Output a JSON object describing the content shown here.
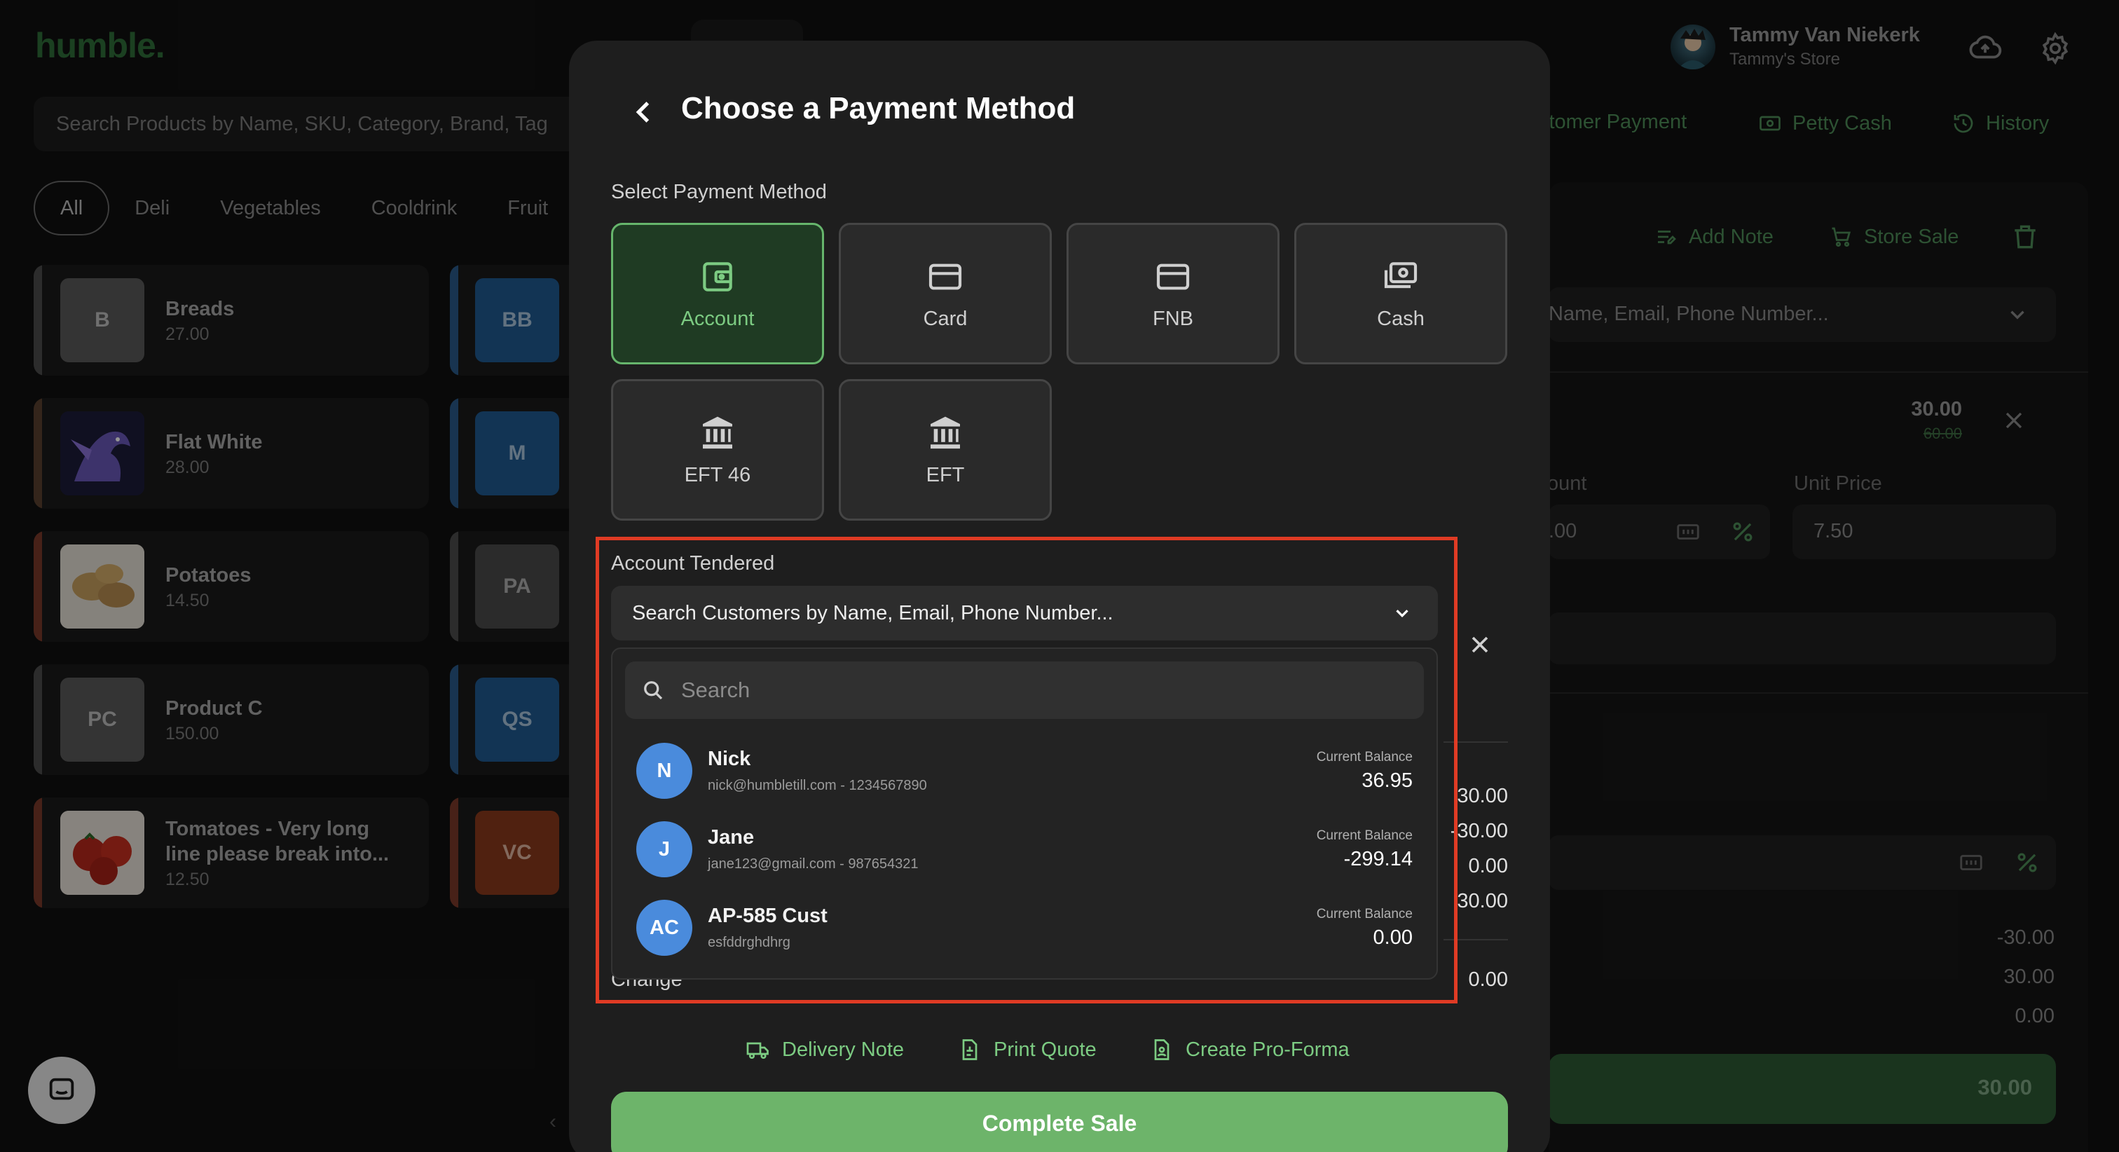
{
  "app": {
    "logo": "humble.",
    "user_name": "Tammy Van Niekerk",
    "store_name": "Tammy's Store",
    "search_placeholder": "Search Products by Name, SKU, Category, Brand, Tag",
    "links": {
      "customer_payment": "stomer Payment",
      "petty_cash": "Petty Cash",
      "history": "History"
    },
    "categories": [
      "All",
      "Deli",
      "Vegetables",
      "Cooldrink",
      "Fruit"
    ],
    "products": [
      {
        "initials": "B",
        "name": "Breads",
        "price": "27.00",
        "bar": "#4d4d4d",
        "thumb": "#5a5a5a"
      },
      {
        "initials": "",
        "name": "Flat White",
        "price": "28.00",
        "bar": "#5a4030",
        "thumb": "#2b2b55"
      },
      {
        "initials": "",
        "name": "Potatoes",
        "price": "14.50",
        "bar": "#7a3a2a",
        "thumb": "#caa46a"
      },
      {
        "initials": "PC",
        "name": "Product C",
        "price": "150.00",
        "bar": "#4d4d4d",
        "thumb": "#5a5a5a"
      },
      {
        "initials": "",
        "name": "Tomatoes - Very long line please break into...",
        "price": "12.50",
        "bar": "#7a3a2a",
        "thumb": "#b33a2a"
      }
    ],
    "tiles": [
      {
        "initials": "BB",
        "color": "#1f5a92"
      },
      {
        "initials": "M",
        "color": "#1f5a92"
      },
      {
        "initials": "PA",
        "color": "#4a4a4a"
      },
      {
        "initials": "QS",
        "color": "#1f5a92"
      },
      {
        "initials": "VC",
        "color": "#8a3a1c"
      }
    ],
    "right": {
      "add_note": "Add Note",
      "store_sale": "Store Sale",
      "customer_search": "Name, Email, Phone Number...",
      "item_price": "30.00",
      "item_old_price": "60.00",
      "discount_label": "ount",
      "discount_value": ".00",
      "unit_price_label": "Unit Price",
      "unit_price_value": "7.50",
      "totals": [
        "-30.00",
        "30.00",
        "0.00"
      ],
      "pay_total": "30.00"
    }
  },
  "modal": {
    "title": "Choose a Payment Method",
    "select_label": "Select Payment Method",
    "methods": [
      {
        "label": "Account",
        "icon": "wallet-icon"
      },
      {
        "label": "Card",
        "icon": "card-icon"
      },
      {
        "label": "FNB",
        "icon": "card-icon"
      },
      {
        "label": "Cash",
        "icon": "cash-icon"
      },
      {
        "label": "EFT 46",
        "icon": "bank-icon"
      },
      {
        "label": "EFT",
        "icon": "bank-icon"
      }
    ],
    "account_tendered_label": "Account Tendered",
    "customer_select_placeholder": "Search Customers by Name, Email, Phone Number...",
    "dropdown_search_placeholder": "Search",
    "customers": [
      {
        "initials": "N",
        "name": "Nick",
        "sub": "nick@humbletill.com - 1234567890",
        "balance_label": "Current Balance",
        "balance": "36.95"
      },
      {
        "initials": "J",
        "name": "Jane",
        "sub": "jane123@gmail.com - 987654321",
        "balance_label": "Current Balance",
        "balance": "-299.14"
      },
      {
        "initials": "AC",
        "name": "AP-585 Cust",
        "sub": "esfddrghdhrg",
        "balance_label": "Current Balance",
        "balance": "0.00"
      }
    ],
    "summary_values": [
      "30.00",
      "-30.00",
      "0.00",
      "30.00"
    ],
    "change_label": "Change",
    "change_value": "0.00",
    "delivery_note": "Delivery Note",
    "print_quote": "Print Quote",
    "create_pro_forma": "Create Pro-Forma",
    "complete_sale": "Complete Sale"
  },
  "colors": {
    "accent_green": "#6db46a",
    "highlight_red": "#e03b24",
    "avatar_blue": "#4a8bdc"
  }
}
